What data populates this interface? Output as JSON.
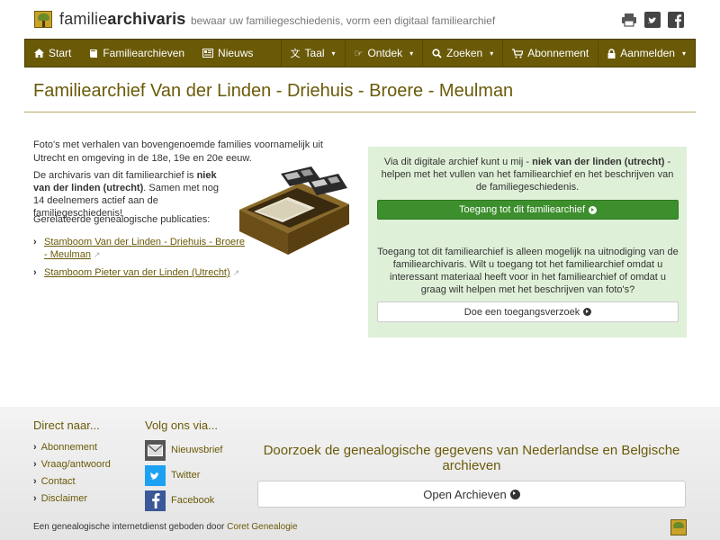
{
  "header": {
    "logo_prefix": "familie",
    "logo_bold": "archivaris",
    "tagline": "bewaar uw familiegeschiedenis, vorm een digitaal familiearchief"
  },
  "nav": {
    "start": "Start",
    "familiearchieven": "Familiearchieven",
    "nieuws": "Nieuws",
    "taal": "Taal",
    "ontdek": "Ontdek",
    "zoeken": "Zoeken",
    "abonnement": "Abonnement",
    "aanmelden": "Aanmelden"
  },
  "page": {
    "title": "Familiearchief Van der Linden - Driehuis - Broere - Meulman",
    "intro": "Foto's met verhalen van bovengenoemde families voornamelijk uit Utrecht en omgeving in de 18e, 19e en 20e eeuw.",
    "archivist_prefix": "De archivaris van dit familiearchief is ",
    "archivist_name": "niek van der linden (utrecht)",
    "archivist_suffix": ". Samen met nog 14 deelnemers actief aan de familiegeschiedenis!",
    "related_label": "Gerelateerde genealogische publicaties:",
    "publications": [
      "Stamboom Van der Linden - Driehuis - Broere - Meulman",
      "Stamboom Pieter van der Linden (Utrecht)"
    ]
  },
  "panel": {
    "text1_prefix": "Via dit digitale archief kunt u mij - ",
    "text1_name": "niek van der linden (utrecht)",
    "text1_suffix": " - helpen met het vullen van het familiearchief en het beschrijven van de familiegeschiedenis.",
    "access_button": "Toegang tot dit familiearchief",
    "text2": "Toegang tot dit familiearchief is alleen mogelijk na uitnodiging van de familiearchivaris. Wilt u toegang tot het familiearchief omdat u interessant materiaal heeft voor in het familiearchief of omdat u graag wilt helpen met het beschrijven van foto's?",
    "request_button": "Doe een toegangsverzoek"
  },
  "footer": {
    "direct_heading": "Direct naar...",
    "direct_links": [
      "Abonnement",
      "Vraag/antwoord",
      "Contact",
      "Disclaimer"
    ],
    "follow_heading": "Volg ons via...",
    "social": [
      "Nieuwsbrief",
      "Twitter",
      "Facebook"
    ],
    "search_title": "Doorzoek de genealogische gegevens van Nederlandse en Belgische archieven",
    "open_button": "Open Archieven",
    "credit_prefix": "Een genealogische internetdienst geboden door ",
    "credit_link": "Coret Genealogie"
  },
  "colors": {
    "brand": "#6a5a08",
    "panel_bg": "#dff0d8",
    "button_green": "#3d8f2e"
  }
}
